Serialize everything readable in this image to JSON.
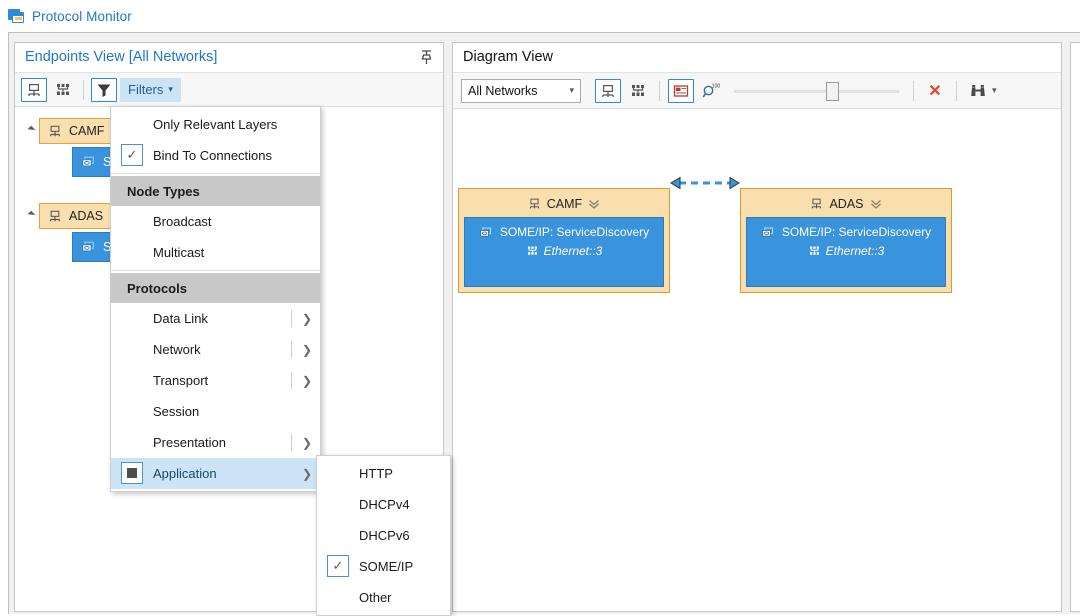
{
  "window": {
    "title": "Protocol Monitor",
    "icon": "window-icon"
  },
  "endpoints_panel": {
    "title": "Endpoints View [All Networks]",
    "pin_icon": "pin-icon",
    "toolbar": {
      "buttons": [
        {
          "name": "endpoint-node-button",
          "icon": "endpoint-node-icon",
          "selected": true
        },
        {
          "name": "network-nodes-button",
          "icon": "network-nodes-icon",
          "selected": false
        },
        {
          "name": "filter-button",
          "icon": "funnel-icon",
          "selected": true
        }
      ],
      "filters_label": "Filters",
      "filters_caret": "chevron-down-icon"
    },
    "tree": [
      {
        "label": "CAMF",
        "icon": "endpoint-node-icon",
        "expander": "triangle-down-icon",
        "child": {
          "label": "SOME/IP: ServiceDiscovery",
          "icon": "message-icon"
        }
      },
      {
        "label": "ADAS",
        "icon": "endpoint-node-icon",
        "expander": "triangle-down-icon",
        "child": {
          "label": "SOME/IP: ServiceDiscovery",
          "icon": "message-icon"
        }
      }
    ]
  },
  "diagram_panel": {
    "title": "Diagram View",
    "toolbar": {
      "network_select": {
        "value": "All Networks",
        "caret": "chevron-down-icon"
      },
      "buttons": [
        {
          "name": "endpoint-node-button",
          "icon": "endpoint-node-icon",
          "selected": true
        },
        {
          "name": "network-nodes-button",
          "icon": "network-nodes-icon",
          "selected": false
        },
        {
          "name": "show-labels-button",
          "icon": "label-box-icon",
          "selected": true
        },
        {
          "name": "zoom-100-button",
          "icon": "magnifier-100-icon",
          "selected": false
        }
      ],
      "zoom_slider": {
        "name": "zoom-slider",
        "value": 55
      },
      "clear_button": {
        "name": "clear-button",
        "icon": "close-x-icon",
        "label": "✕"
      },
      "find_button": {
        "name": "find-button",
        "icon": "binoculars-icon",
        "caret": "chevron-down-icon"
      }
    },
    "nodes": [
      {
        "name": "CAMF",
        "header_icon": "endpoint-node-icon",
        "collapse_icon": "double-chevron-down-icon",
        "protocol": "SOME/IP:  ServiceDiscovery",
        "protocol_icon": "message-icon",
        "interface": "Ethernet::3",
        "interface_icon": "network-nodes-icon"
      },
      {
        "name": "ADAS",
        "header_icon": "endpoint-node-icon",
        "collapse_icon": "double-chevron-down-icon",
        "protocol": "SOME/IP:  ServiceDiscovery",
        "protocol_icon": "message-icon",
        "interface": "Ethernet::3",
        "interface_icon": "network-nodes-icon"
      }
    ],
    "connector": {
      "name": "bidirectional-connector",
      "style": "dashed",
      "color": "#3a94dd"
    }
  },
  "filters_menu": {
    "items": [
      {
        "label": "Only Relevant Layers",
        "type": "check",
        "checked": false,
        "submenu": false,
        "highlighted": false
      },
      {
        "label": "Bind To Connections",
        "type": "check",
        "checked": true,
        "submenu": false,
        "highlighted": false
      },
      {
        "label": "Node Types",
        "type": "header"
      },
      {
        "label": "Broadcast",
        "type": "check",
        "checked": false,
        "submenu": false,
        "highlighted": false
      },
      {
        "label": "Multicast",
        "type": "check",
        "checked": false,
        "submenu": false,
        "highlighted": false
      },
      {
        "label": "Protocols",
        "type": "header"
      },
      {
        "label": "Data Link",
        "type": "check",
        "checked": false,
        "submenu": true,
        "highlighted": false
      },
      {
        "label": "Network",
        "type": "check",
        "checked": false,
        "submenu": true,
        "highlighted": false
      },
      {
        "label": "Transport",
        "type": "check",
        "checked": false,
        "submenu": true,
        "highlighted": false
      },
      {
        "label": "Session",
        "type": "check",
        "checked": false,
        "submenu": false,
        "highlighted": false
      },
      {
        "label": "Presentation",
        "type": "check",
        "checked": false,
        "submenu": true,
        "highlighted": false
      },
      {
        "label": "Application",
        "type": "partial",
        "checked": false,
        "submenu": true,
        "highlighted": true
      }
    ]
  },
  "application_submenu": {
    "items": [
      {
        "label": "HTTP",
        "checked": false
      },
      {
        "label": "DHCPv4",
        "checked": false
      },
      {
        "label": "DHCPv6",
        "checked": false
      },
      {
        "label": "SOME/IP",
        "checked": true
      },
      {
        "label": "Other",
        "checked": false
      }
    ]
  },
  "colors": {
    "accent": "#1e78c8",
    "node_header": "#fadfae",
    "node_header_border": "#d89a35",
    "node_body": "#3a94dd",
    "highlight": "#cde4f7",
    "close_red": "#e8432a"
  }
}
